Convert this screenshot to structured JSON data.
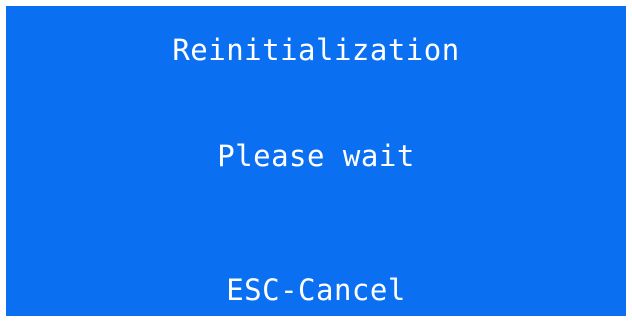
{
  "screen": {
    "title": "Reinitialization",
    "message": "Please wait",
    "cancel_hint": "ESC-Cancel"
  },
  "colors": {
    "background": "#0b6ff2",
    "text": "#ffffff"
  }
}
